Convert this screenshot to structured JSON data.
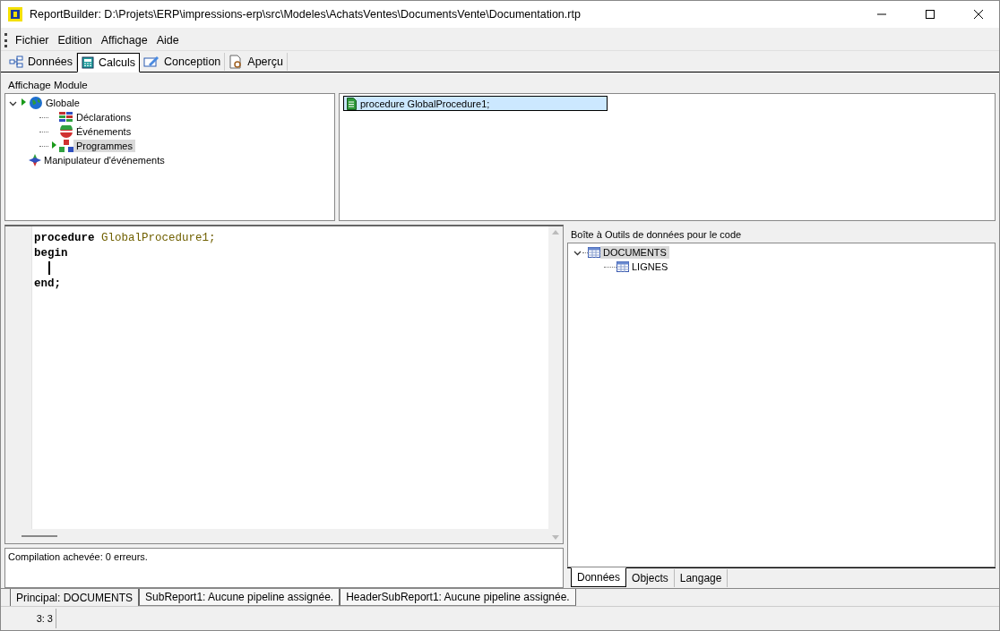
{
  "window": {
    "title": "ReportBuilder: D:\\Projets\\ERP\\impressions-erp\\src\\Modeles\\AchatsVentes\\DocumentsVente\\Documentation.rtp"
  },
  "menu": [
    "Fichier",
    "Edition",
    "Affichage",
    "Aide"
  ],
  "tabs": [
    {
      "label": "Données",
      "kind": "data",
      "selected": false
    },
    {
      "label": "Calculs",
      "kind": "calc",
      "selected": true
    },
    {
      "label": "Conception",
      "kind": "design",
      "selected": false
    },
    {
      "label": "Aperçu",
      "kind": "preview",
      "selected": false
    }
  ],
  "module_view": {
    "title": "Affichage Module",
    "tree": [
      {
        "label": "Globale",
        "kind": "globe",
        "marked": true,
        "expanded": true,
        "selected": false,
        "children": [
          {
            "label": "Déclarations",
            "kind": "grid",
            "marked": false,
            "selected": false
          },
          {
            "label": "Événements",
            "kind": "events",
            "marked": false,
            "selected": false
          },
          {
            "label": "Programmes",
            "kind": "programs",
            "marked": true,
            "selected": true
          }
        ]
      },
      {
        "label": "Manipulateur d'événements",
        "kind": "handler",
        "marked": false,
        "selected": false
      }
    ]
  },
  "procedures": [
    {
      "label": "procedure GlobalProcedure1;",
      "selected": true
    }
  ],
  "code": [
    {
      "caret": false,
      "tokens": [
        {
          "text": "procedure",
          "kind": "keyword"
        },
        {
          "text": "GlobalProcedure1;",
          "kind": "ident"
        }
      ]
    },
    {
      "caret": false,
      "tokens": [
        {
          "text": "begin",
          "kind": "keyword"
        }
      ]
    },
    {
      "caret": true
    },
    {
      "caret": false,
      "tokens": [
        {
          "text": "end;",
          "kind": "keyword"
        }
      ]
    }
  ],
  "message": "Compilation achevée: 0 erreurs.",
  "toolbox": {
    "title": "Boîte à Outils de données pour le code",
    "tree": [
      {
        "label": "DOCUMENTS",
        "expanded": true,
        "selected": true,
        "children": [
          {
            "label": "LIGNES",
            "selected": false
          }
        ]
      }
    ],
    "tabs": [
      {
        "label": "Données",
        "selected": true
      },
      {
        "label": "Objects",
        "selected": false
      },
      {
        "label": "Langage",
        "selected": false
      }
    ]
  },
  "report_tabs": [
    {
      "label": "Principal: DOCUMENTS",
      "selected": true
    },
    {
      "label": "SubReport1: Aucune pipeline assignée.",
      "selected": false
    },
    {
      "label": "HeaderSubReport1: Aucune pipeline assignée.",
      "selected": false
    }
  ],
  "status_bar": {
    "position": "3: 3"
  }
}
